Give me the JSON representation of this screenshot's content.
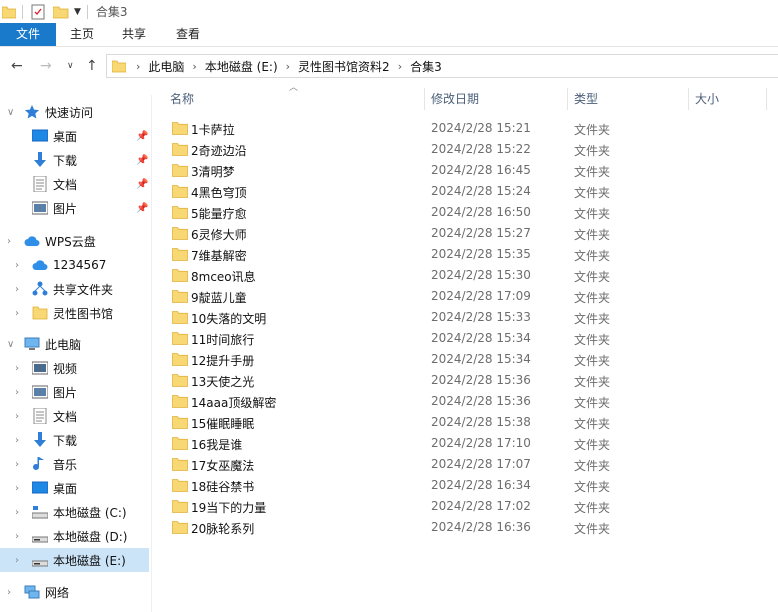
{
  "window": {
    "title": "合集3"
  },
  "ribbon": {
    "tabs": [
      "文件",
      "主页",
      "共享",
      "查看"
    ]
  },
  "address": {
    "crumbs": [
      "此电脑",
      "本地磁盘 (E:)",
      "灵性图书馆资料2",
      "合集3"
    ]
  },
  "columns": {
    "name": "名称",
    "date": "修改日期",
    "type": "类型",
    "size": "大小"
  },
  "navpane": {
    "quick_access": "快速访问",
    "quick_items": [
      "桌面",
      "下载",
      "文档",
      "图片"
    ],
    "wps": "WPS云盘",
    "wps_items": [
      "1234567",
      "共享文件夹",
      "灵性图书馆"
    ],
    "this_pc": "此电脑",
    "pc_items": [
      "视频",
      "图片",
      "文档",
      "下载",
      "音乐",
      "桌面",
      "本地磁盘 (C:)",
      "本地磁盘 (D:)",
      "本地磁盘 (E:)"
    ],
    "network": "网络"
  },
  "files": [
    {
      "name": "1卡萨拉",
      "date": "2024/2/28 15:21",
      "type": "文件夹"
    },
    {
      "name": "2奇迹边沿",
      "date": "2024/2/28 15:22",
      "type": "文件夹"
    },
    {
      "name": "3清明梦",
      "date": "2024/2/28 16:45",
      "type": "文件夹"
    },
    {
      "name": "4黑色穹顶",
      "date": "2024/2/28 15:24",
      "type": "文件夹"
    },
    {
      "name": "5能量疗愈",
      "date": "2024/2/28 16:50",
      "type": "文件夹"
    },
    {
      "name": "6灵修大师",
      "date": "2024/2/28 15:27",
      "type": "文件夹"
    },
    {
      "name": "7维基解密",
      "date": "2024/2/28 15:35",
      "type": "文件夹"
    },
    {
      "name": "8mceo讯息",
      "date": "2024/2/28 15:30",
      "type": "文件夹"
    },
    {
      "name": "9靛蓝儿童",
      "date": "2024/2/28 17:09",
      "type": "文件夹"
    },
    {
      "name": "10失落的文明",
      "date": "2024/2/28 15:33",
      "type": "文件夹"
    },
    {
      "name": "11时间旅行",
      "date": "2024/2/28 15:34",
      "type": "文件夹"
    },
    {
      "name": "12提升手册",
      "date": "2024/2/28 15:34",
      "type": "文件夹"
    },
    {
      "name": "13天使之光",
      "date": "2024/2/28 15:36",
      "type": "文件夹"
    },
    {
      "name": "14aaa顶级解密",
      "date": "2024/2/28 15:36",
      "type": "文件夹"
    },
    {
      "name": "15催眠睡眠",
      "date": "2024/2/28 15:38",
      "type": "文件夹"
    },
    {
      "name": "16我是谁",
      "date": "2024/2/28 17:10",
      "type": "文件夹"
    },
    {
      "name": "17女巫魔法",
      "date": "2024/2/28 17:07",
      "type": "文件夹"
    },
    {
      "name": "18硅谷禁书",
      "date": "2024/2/28 16:34",
      "type": "文件夹"
    },
    {
      "name": "19当下的力量",
      "date": "2024/2/28 17:02",
      "type": "文件夹"
    },
    {
      "name": "20脉轮系列",
      "date": "2024/2/28 16:36",
      "type": "文件夹"
    }
  ]
}
